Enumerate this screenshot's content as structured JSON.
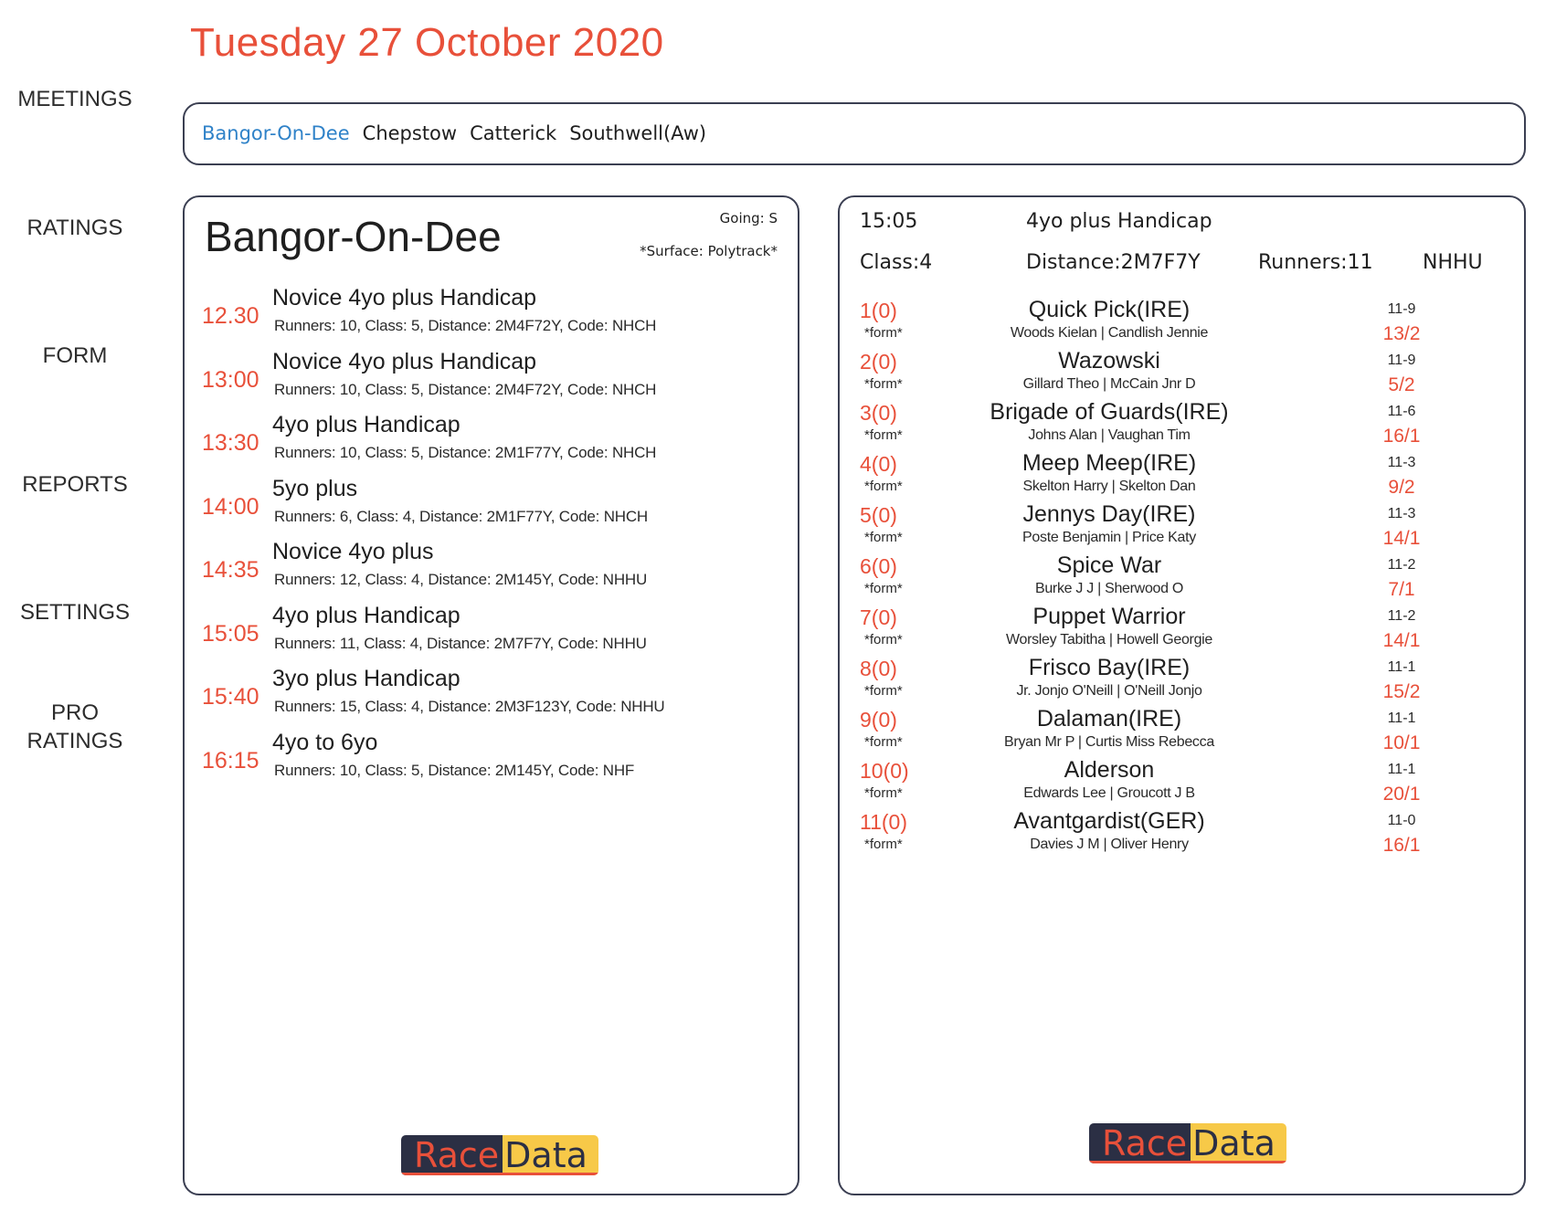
{
  "page_title": "Tuesday 27 October 2020",
  "nav": {
    "meetings": "MEETINGS",
    "ratings": "RATINGS",
    "form": "FORM",
    "reports": "REPORTS",
    "settings": "SETTINGS",
    "pro_ratings_1": "PRO",
    "pro_ratings_2": "RATINGS"
  },
  "meetings": [
    "Bangor-On-Dee",
    "Chepstow",
    "Catterick",
    "Southwell(Aw)"
  ],
  "venue": {
    "name": "Bangor-On-Dee",
    "going": "Going: S",
    "surface": "*Surface: Polytrack*",
    "races": [
      {
        "time": "12.30",
        "name": "Novice 4yo plus Handicap",
        "meta": "Runners: 10, Class: 5, Distance: 2M4F72Y, Code: NHCH"
      },
      {
        "time": "13:00",
        "name": "Novice 4yo plus Handicap",
        "meta": "Runners: 10, Class: 5, Distance: 2M4F72Y, Code: NHCH"
      },
      {
        "time": "13:30",
        "name": "4yo plus Handicap",
        "meta": "Runners: 10, Class: 5, Distance: 2M1F77Y, Code: NHCH"
      },
      {
        "time": "14:00",
        "name": "5yo plus",
        "meta": "Runners: 6, Class: 4, Distance: 2M1F77Y, Code: NHCH"
      },
      {
        "time": "14:35",
        "name": "Novice 4yo plus",
        "meta": "Runners: 12, Class: 4, Distance: 2M145Y, Code: NHHU"
      },
      {
        "time": "15:05",
        "name": "4yo plus Handicap",
        "meta": "Runners: 11, Class: 4, Distance: 2M7F7Y, Code: NHHU"
      },
      {
        "time": "15:40",
        "name": "3yo plus Handicap",
        "meta": "Runners: 15, Class: 4, Distance: 2M3F123Y, Code: NHHU"
      },
      {
        "time": "16:15",
        "name": "4yo to 6yo",
        "meta": "Runners: 10, Class: 5, Distance: 2M145Y, Code: NHF"
      }
    ]
  },
  "logo": {
    "race": "Race",
    "data": "Data"
  },
  "card": {
    "time": "15:05",
    "title": "4yo plus Handicap",
    "class": "Class:4",
    "distance": "Distance:2M7F7Y",
    "runners": "Runners:11",
    "code": "NHHU",
    "runners_list": [
      {
        "num": "1(0)",
        "form": "*form*",
        "name": "Quick Pick(IRE)",
        "people": "Woods Kielan | Candlish Jennie",
        "weight": "11-9",
        "odds": "13/2"
      },
      {
        "num": "2(0)",
        "form": "*form*",
        "name": "Wazowski",
        "people": "Gillard Theo | McCain Jnr D",
        "weight": "11-9",
        "odds": "5/2"
      },
      {
        "num": "3(0)",
        "form": "*form*",
        "name": "Brigade of Guards(IRE)",
        "people": "Johns Alan | Vaughan Tim",
        "weight": "11-6",
        "odds": "16/1"
      },
      {
        "num": "4(0)",
        "form": "*form*",
        "name": "Meep Meep(IRE)",
        "people": "Skelton Harry | Skelton Dan",
        "weight": "11-3",
        "odds": "9/2"
      },
      {
        "num": "5(0)",
        "form": "*form*",
        "name": "Jennys Day(IRE)",
        "people": "Poste Benjamin | Price Katy",
        "weight": "11-3",
        "odds": "14/1"
      },
      {
        "num": "6(0)",
        "form": "*form*",
        "name": "Spice War",
        "people": "Burke J J | Sherwood O",
        "weight": "11-2",
        "odds": "7/1"
      },
      {
        "num": "7(0)",
        "form": "*form*",
        "name": "Puppet Warrior",
        "people": "Worsley Tabitha | Howell Georgie",
        "weight": "11-2",
        "odds": "14/1"
      },
      {
        "num": "8(0)",
        "form": "*form*",
        "name": "Frisco Bay(IRE)",
        "people": "Jr. Jonjo O'Neill | O'Neill Jonjo",
        "weight": "11-1",
        "odds": "15/2"
      },
      {
        "num": "9(0)",
        "form": "*form*",
        "name": "Dalaman(IRE)",
        "people": "Bryan Mr P | Curtis Miss Rebecca",
        "weight": "11-1",
        "odds": "10/1"
      },
      {
        "num": "10(0)",
        "form": "*form*",
        "name": "Alderson",
        "people": "Edwards Lee | Groucott J B",
        "weight": "11-1",
        "odds": "20/1"
      },
      {
        "num": "11(0)",
        "form": "*form*",
        "name": "Avantgardist(GER)",
        "people": "Davies J M | Oliver Henry",
        "weight": "11-0",
        "odds": "16/1"
      }
    ]
  },
  "colors": {
    "accent": "#e8503a",
    "link": "#2f82c8",
    "border": "#3b3f52",
    "logo_dark": "#2b2f44",
    "logo_yellow": "#f7c948"
  }
}
